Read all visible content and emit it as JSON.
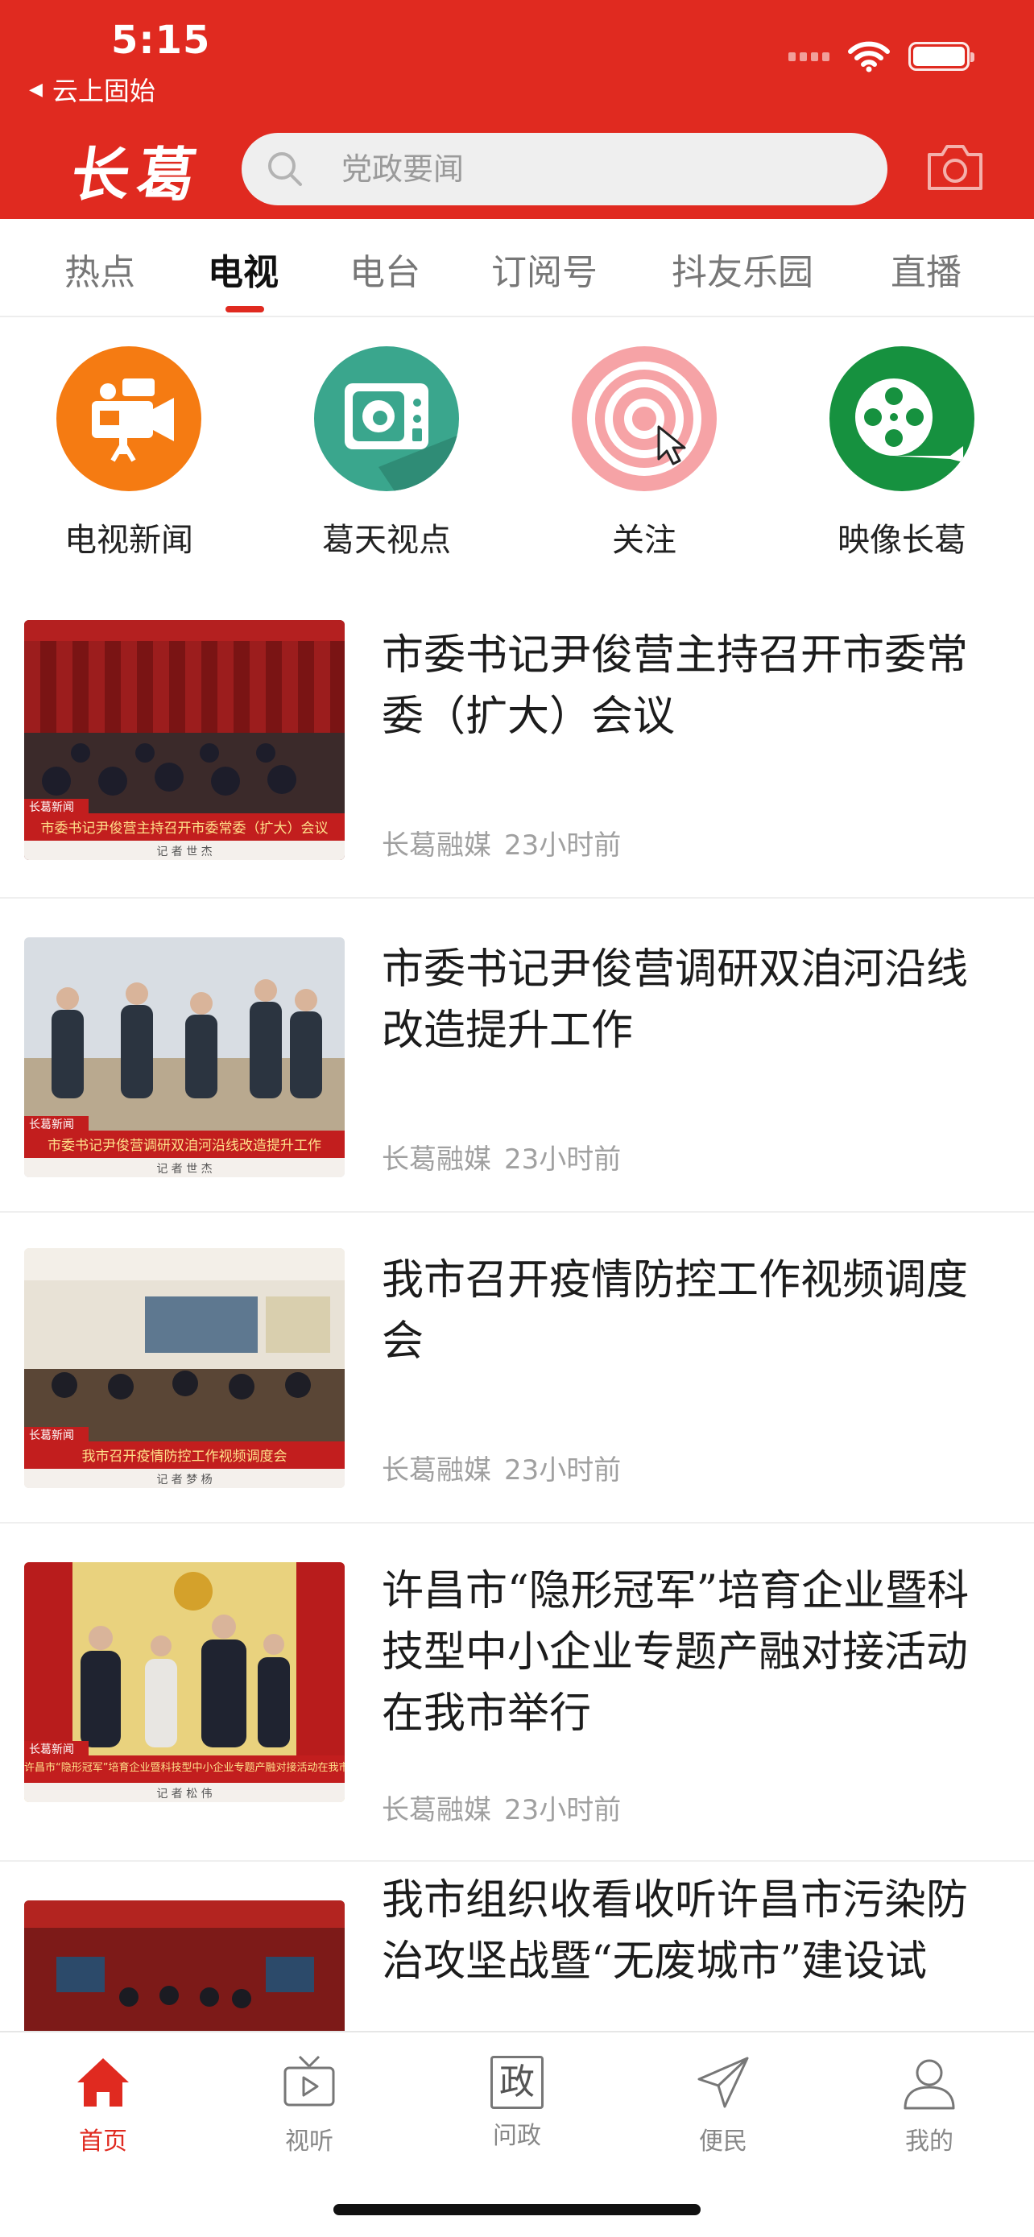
{
  "status_bar": {
    "time": "5:15",
    "back_app": "云上固始"
  },
  "header": {
    "logo": "长葛",
    "search_placeholder": "党政要闻"
  },
  "tabs": [
    {
      "label": "热点",
      "active": false
    },
    {
      "label": "电视",
      "active": true
    },
    {
      "label": "电台",
      "active": false
    },
    {
      "label": "订阅号",
      "active": false
    },
    {
      "label": "抖友乐园",
      "active": false
    },
    {
      "label": "直播",
      "active": false
    }
  ],
  "shortcuts": [
    {
      "label": "电视新闻",
      "icon": "tv-camera-icon",
      "color": "#f57b12"
    },
    {
      "label": "葛天视点",
      "icon": "retro-tv-icon",
      "color": "#3aa68d"
    },
    {
      "label": "关注",
      "icon": "target-icon",
      "color": "#f6a3a6"
    },
    {
      "label": "映像长葛",
      "icon": "film-reel-icon",
      "color": "#16913f"
    }
  ],
  "news": [
    {
      "title": "市委书记尹俊营主持召开市委常委（扩大）会议",
      "source": "长葛融媒",
      "time": "23小时前",
      "thumb_tag": "长葛新闻",
      "thumb_caption": "市委书记尹俊营主持召开市委常委（扩大）会议",
      "thumb_reporter": "记 者  世 杰"
    },
    {
      "title": "市委书记尹俊营调研双洎河沿线改造提升工作",
      "source": "长葛融媒",
      "time": "23小时前",
      "thumb_tag": "长葛新闻",
      "thumb_caption": "市委书记尹俊营调研双洎河沿线改造提升工作",
      "thumb_reporter": "记 者  世 杰"
    },
    {
      "title": "我市召开疫情防控工作视频调度会",
      "source": "长葛融媒",
      "time": "23小时前",
      "thumb_tag": "长葛新闻",
      "thumb_caption": "我市召开疫情防控工作视频调度会",
      "thumb_reporter": "记 者  梦 杨"
    },
    {
      "title": "许昌市“隐形冠军”培育企业暨科技型中小企业专题产融对接活动在我市举行",
      "source": "长葛融媒",
      "time": "23小时前",
      "thumb_tag": "长葛新闻",
      "thumb_caption": "许昌市“隐形冠军”培育企业暨科技型中小企业专题产融对接活动在我市举行",
      "thumb_reporter": "记 者  松 伟"
    },
    {
      "title": "我市组织收看收听许昌市污染防治攻坚战暨“无废城市”建设试",
      "source": "",
      "time": "",
      "thumb_tag": "",
      "thumb_caption": "",
      "thumb_reporter": ""
    }
  ],
  "bottom_nav": [
    {
      "label": "首页",
      "icon": "home-icon",
      "active": true
    },
    {
      "label": "视听",
      "icon": "tv-play-icon",
      "active": false
    },
    {
      "label": "问政",
      "icon": "zheng-icon",
      "glyph": "政",
      "active": false
    },
    {
      "label": "便民",
      "icon": "paper-plane-icon",
      "active": false
    },
    {
      "label": "我的",
      "icon": "user-icon",
      "active": false
    }
  ],
  "colors": {
    "brand_red": "#e02a20",
    "tab_active": "#111111",
    "meta_gray": "#a0a0a0"
  }
}
